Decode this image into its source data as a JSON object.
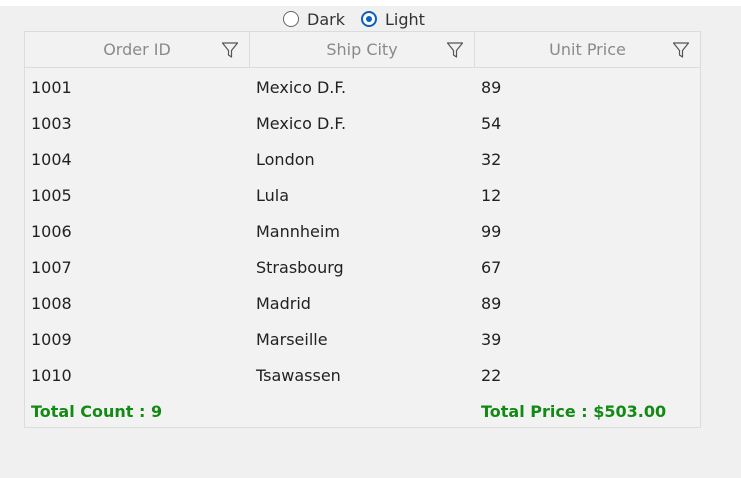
{
  "theme": {
    "options": [
      {
        "label": "Dark",
        "checked": false
      },
      {
        "label": "Light",
        "checked": true
      }
    ]
  },
  "grid": {
    "columns": [
      "Order ID",
      "Ship City",
      "Unit Price"
    ],
    "rows": [
      [
        "1001",
        "Mexico D.F.",
        "89"
      ],
      [
        "1003",
        "Mexico D.F.",
        "54"
      ],
      [
        "1004",
        "London",
        "32"
      ],
      [
        "1005",
        "Lula",
        "12"
      ],
      [
        "1006",
        "Mannheim",
        "99"
      ],
      [
        "1007",
        "Strasbourg",
        "67"
      ],
      [
        "1008",
        "Madrid",
        "89"
      ],
      [
        "1009",
        "Marseille",
        "39"
      ],
      [
        "1010",
        "Tsawassen",
        "22"
      ]
    ],
    "footer": {
      "total_count": "Total Count : 9",
      "total_price": "Total Price : $503.00"
    }
  },
  "colors": {
    "accent": "#0b5fc0",
    "summary_text": "#138a13",
    "header_text": "#8a8a8a"
  },
  "icons": {
    "filter": "filter-icon"
  }
}
